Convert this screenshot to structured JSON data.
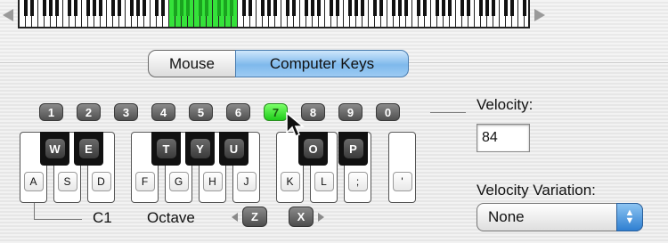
{
  "mode_tabs": {
    "mouse": "Mouse",
    "computer_keys": "Computer Keys",
    "selected": "Computer Keys"
  },
  "number_keys": [
    "1",
    "2",
    "3",
    "4",
    "5",
    "6",
    "7",
    "8",
    "9",
    "0"
  ],
  "active_number_key": "7",
  "white_keys": [
    "A",
    "S",
    "D",
    "F",
    "G",
    "H",
    "J",
    "K",
    "L",
    ";",
    "'"
  ],
  "black_keys": [
    "W",
    "E",
    "T",
    "Y",
    "U",
    "O",
    "P"
  ],
  "velocity": {
    "label": "Velocity:",
    "value": "84"
  },
  "velocity_variation": {
    "label": "Velocity Variation:",
    "value": "None"
  },
  "octave": {
    "note": "C1",
    "label": "Octave",
    "down_key": "Z",
    "up_key": "X"
  },
  "colors": {
    "highlight": "#35e23a",
    "selected_tab": "#7fb9ec",
    "key_dark": "#505050"
  },
  "icons": {
    "cursor": "arrow-cursor-icon",
    "select": "updown-chevron-icon"
  }
}
